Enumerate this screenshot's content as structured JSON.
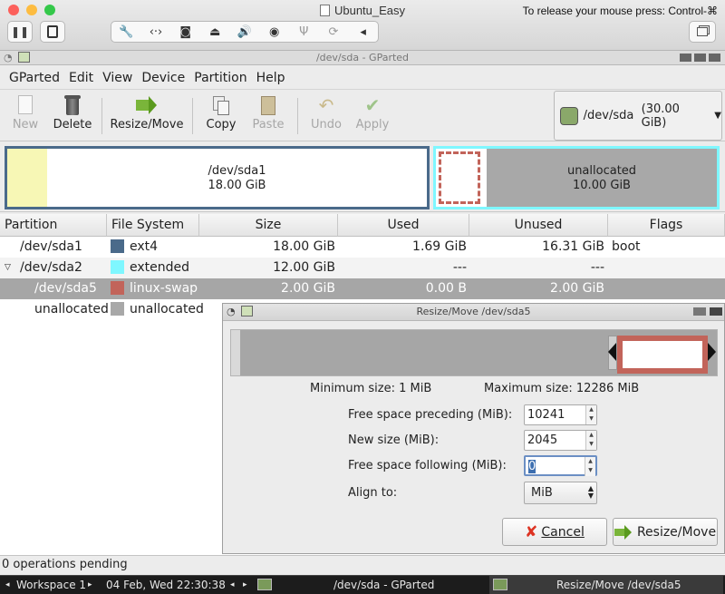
{
  "vm_window": {
    "title": "Ubuntu_Easy",
    "release_hint": "To release your mouse press: Control-⌘",
    "colors": {
      "close": "#fc605b",
      "minimize": "#fdbc40",
      "zoom": "#34c84a"
    }
  },
  "gparted": {
    "window_title": "/dev/sda - GParted",
    "menu": [
      "GParted",
      "Edit",
      "View",
      "Device",
      "Partition",
      "Help"
    ],
    "toolbar": {
      "new": "New",
      "delete": "Delete",
      "resize_move": "Resize/Move",
      "copy": "Copy",
      "paste": "Paste",
      "undo": "Undo",
      "apply": "Apply"
    },
    "device": {
      "name": "/dev/sda",
      "size": "(30.00 GiB)"
    },
    "diskmap": {
      "sda1_name": "/dev/sda1",
      "sda1_size": "18.00 GiB",
      "unalloc_name": "unallocated",
      "unalloc_size": "10.00 GiB"
    },
    "table": {
      "headers": [
        "Partition",
        "File System",
        "Size",
        "Used",
        "Unused",
        "Flags"
      ],
      "rows": [
        {
          "partition": "/dev/sda1",
          "fs": "ext4",
          "fs_color": "#4a6a8a",
          "size": "18.00 GiB",
          "used": "1.69 GiB",
          "unused": "16.31 GiB",
          "flags": "boot"
        },
        {
          "partition": "/dev/sda2",
          "fs": "extended",
          "fs_color": "#7ff7ff",
          "size": "12.00 GiB",
          "used": "---",
          "unused": "---",
          "flags": ""
        },
        {
          "partition": "/dev/sda5",
          "fs": "linux-swap",
          "fs_color": "#c2645a",
          "size": "2.00 GiB",
          "used": "0.00 B",
          "unused": "2.00 GiB",
          "flags": ""
        },
        {
          "partition": "unallocated",
          "fs": "unallocated",
          "fs_color": "#a8a8a8",
          "size": "",
          "used": "",
          "unused": "",
          "flags": ""
        }
      ]
    },
    "status": "0 operations pending"
  },
  "dialog": {
    "title": "Resize/Move /dev/sda5",
    "min_size": "Minimum size: 1 MiB",
    "max_size": "Maximum size: 12286 MiB",
    "fields": {
      "free_preceding_label": "Free space preceding (MiB):",
      "free_preceding_value": "10241",
      "new_size_label": "New size (MiB):",
      "new_size_value": "2045",
      "free_following_label": "Free space following (MiB):",
      "free_following_value": "0",
      "align_label": "Align to:",
      "align_value": "MiB"
    },
    "cancel": "Cancel",
    "resize_move": "Resize/Move"
  },
  "taskbar": {
    "workspace": "Workspace 1",
    "datetime": "04 Feb, Wed 22:30:38",
    "task1": "/dev/sda - GParted",
    "task2": "Resize/Move /dev/sda5"
  }
}
